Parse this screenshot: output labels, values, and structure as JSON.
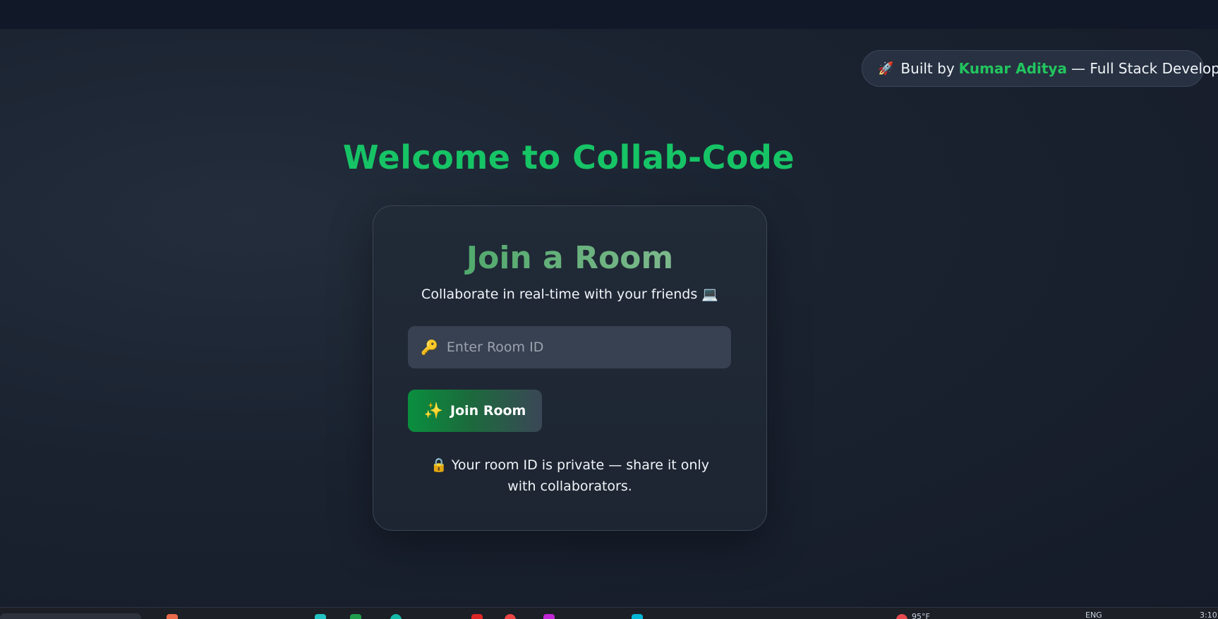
{
  "credit": {
    "rocket_icon": "rocket-icon",
    "prefix": "Built by",
    "name": "Kumar Aditya",
    "suffix": "— Full Stack Developer"
  },
  "main_title": "Welcome to Collab-Code",
  "card": {
    "title": "Join a Room",
    "subtitle": "Collaborate in real-time with your friends 💻",
    "room_input": {
      "icon": "key-icon",
      "placeholder": "Enter Room ID",
      "value": ""
    },
    "join_button": {
      "icon": "sparkle-icon",
      "label": "Join Room"
    },
    "privacy_note": {
      "icon": "lock-icon",
      "text": "Your room ID is private — share it only with collaborators."
    }
  },
  "taskbar": {
    "weather_temp": "95°F",
    "language": "ENG",
    "clock": "3:10"
  },
  "colors": {
    "accent_green": "#16c466",
    "background": "#1a2230",
    "card_bg": "#212a37",
    "input_bg": "#374151"
  }
}
